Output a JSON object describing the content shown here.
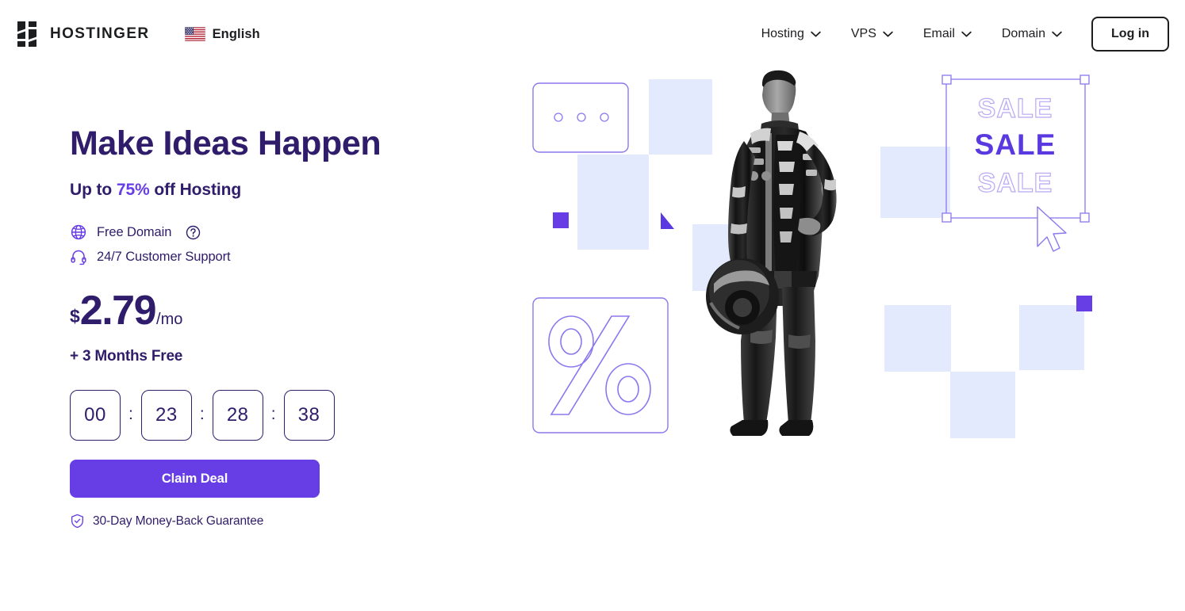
{
  "header": {
    "brand_name": "HOSTINGER",
    "logo_icon": "hostinger-h-logo",
    "language": {
      "label": "English",
      "flag_icon": "us-flag-icon"
    },
    "nav_items": [
      {
        "label": "Hosting",
        "icon": "chevron-down-icon"
      },
      {
        "label": "VPS",
        "icon": "chevron-down-icon"
      },
      {
        "label": "Email",
        "icon": "chevron-down-icon"
      },
      {
        "label": "Domain",
        "icon": "chevron-down-icon"
      }
    ],
    "login_label": "Log in"
  },
  "hero": {
    "headline": "Make Ideas Happen",
    "subhead_prefix": "Up to ",
    "subhead_percent": "75%",
    "subhead_suffix": " off Hosting",
    "features": [
      {
        "label": "Free Domain",
        "icon": "globe-icon",
        "help_icon": "question-circle-icon"
      },
      {
        "label": "24/7 Customer Support",
        "icon": "headset-icon"
      }
    ],
    "price": {
      "currency": "$",
      "amount": "2.79",
      "period": "/mo"
    },
    "months_free": "+ 3 Months Free",
    "timer": {
      "days": "00",
      "hours": "23",
      "minutes": "28",
      "seconds": "38",
      "separator": ":"
    },
    "cta_label": "Claim Deal",
    "guarantee": {
      "label": "30-Day Money-Back Guarantee",
      "icon": "shield-check-icon"
    }
  },
  "artwork": {
    "sale_text_top": "SALE",
    "sale_text_middle": "SALE",
    "sale_text_bottom": "SALE",
    "percent_symbol": "%",
    "person_alt": "racing-driver-photo"
  },
  "colors": {
    "brand_violet": "#673DE6",
    "deep_purple": "#2F1C6A",
    "light_blue": "#E3EAFD",
    "ink": "#1D1E20"
  }
}
